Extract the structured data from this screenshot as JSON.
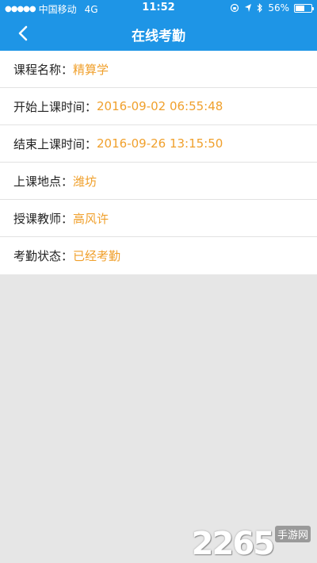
{
  "status_bar": {
    "carrier": "中国移动",
    "network": "4G",
    "time": "11:52",
    "battery_percent": "56%",
    "battery_level": 0.56
  },
  "nav": {
    "title": "在线考勤",
    "back_icon": "chevron-left-icon"
  },
  "fields": [
    {
      "label": "课程名称：",
      "value": "精算学"
    },
    {
      "label": "开始上课时间：",
      "value": "2016-09-02 06:55:48"
    },
    {
      "label": "结束上课时间：",
      "value": "2016-09-26 13:15:50"
    },
    {
      "label": "上课地点：",
      "value": "潍坊"
    },
    {
      "label": "授课教师：",
      "value": "高风许"
    },
    {
      "label": "考勤状态：",
      "value": "已经考勤"
    }
  ],
  "watermark": {
    "number": "2265",
    "suffix": "手游网"
  },
  "colors": {
    "header": "#1e95e6",
    "value_text": "#f0a02c",
    "background": "#e6e6e6"
  }
}
